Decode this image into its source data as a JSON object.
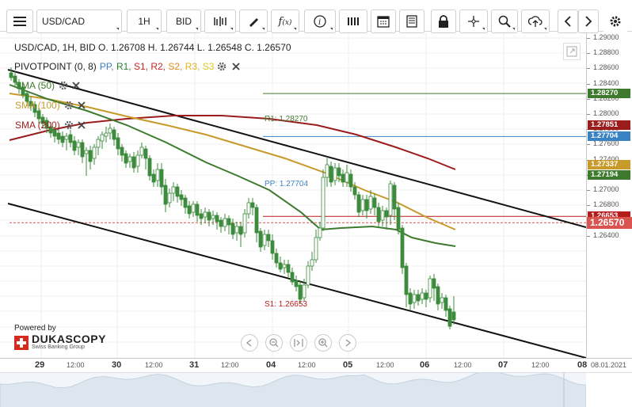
{
  "toolbar": {
    "symbol": "USD/CAD",
    "timeframe": "1H",
    "side": "BID",
    "icons": [
      "menu-icon",
      "bar-type-icon",
      "draw-icon",
      "function-icon",
      "info-icon",
      "calendar-icon",
      "news-icon",
      "lock-icon",
      "crosshair-icon",
      "zoom-icon",
      "upload-icon",
      "prev-icon",
      "next-icon",
      "settings-icon"
    ]
  },
  "info": {
    "text": "USD/CAD, 1H, BID   O. 1.26708 H. 1.26744 L. 1.26548 C. 1.26570"
  },
  "pivot": {
    "prefix": "PIVOTPOINT (0, 8)",
    "items": [
      {
        "label": "PP,",
        "color": "#3b82c4"
      },
      {
        "label": "R1,",
        "color": "#2e7d32"
      },
      {
        "label": "S1,",
        "color": "#c62828"
      },
      {
        "label": "R2,",
        "color": "#c62828"
      },
      {
        "label": "S2,",
        "color": "#e08a1e"
      },
      {
        "label": "R3,",
        "color": "#e0b31e"
      },
      {
        "label": "S3",
        "color": "#e0c81e"
      }
    ]
  },
  "indicators": [
    {
      "label": "SMA (50)",
      "color": "#3d7a2e"
    },
    {
      "label": "SMA (100)",
      "color": "#c79a2a"
    },
    {
      "label": "SMA (200)",
      "color": "#9b1c1c"
    }
  ],
  "levels": {
    "r1": {
      "label": "R1: 1.28270",
      "tag": "1.28270",
      "color": "#3d7a2e"
    },
    "pp": {
      "label": "PP: 1.27704",
      "tag": "1.27704",
      "color": "#3b82c4"
    },
    "s1": {
      "label": "S1: 1.26653",
      "tag": "1.26653",
      "color": "#b71c1c"
    }
  },
  "sma_tags": {
    "sma200": {
      "value": "1.27851",
      "color": "#9b1c1c"
    },
    "sma100": {
      "value": "1.27337",
      "color": "#c79a2a"
    },
    "sma50": {
      "value": "1.27194",
      "color": "#3d7a2e"
    }
  },
  "current_price": {
    "value": "1.26570",
    "color": "#d9534f"
  },
  "price_axis": [
    "1.29000",
    "1.28800",
    "1.28600",
    "1.28400",
    "1.28200",
    "1.28000",
    "1.27800",
    "1.27600",
    "1.27400",
    "1.27200",
    "1.27000",
    "1.26800",
    "1.26600",
    "1.26400"
  ],
  "time_axis": [
    {
      "label": "29",
      "day": true
    },
    {
      "label": "12:00",
      "day": false
    },
    {
      "label": "30",
      "day": true
    },
    {
      "label": "12:00",
      "day": false
    },
    {
      "label": "31",
      "day": true
    },
    {
      "label": "12:00",
      "day": false
    },
    {
      "label": "04",
      "day": true
    },
    {
      "label": "12:00",
      "day": false
    },
    {
      "label": "05",
      "day": true
    },
    {
      "label": "12:00",
      "day": false
    },
    {
      "label": "06",
      "day": true
    },
    {
      "label": "12:00",
      "day": false
    },
    {
      "label": "07",
      "day": true
    },
    {
      "label": "12:00",
      "day": false
    },
    {
      "label": "08",
      "day": true
    }
  ],
  "date_stamp": "08.01.2021",
  "branding": {
    "powered": "Powered by",
    "name": "DUKASCOPY",
    "sub": "Swiss Banking Group"
  },
  "colors": {
    "candle": "#3d8b3d",
    "channel": "#111111"
  }
}
